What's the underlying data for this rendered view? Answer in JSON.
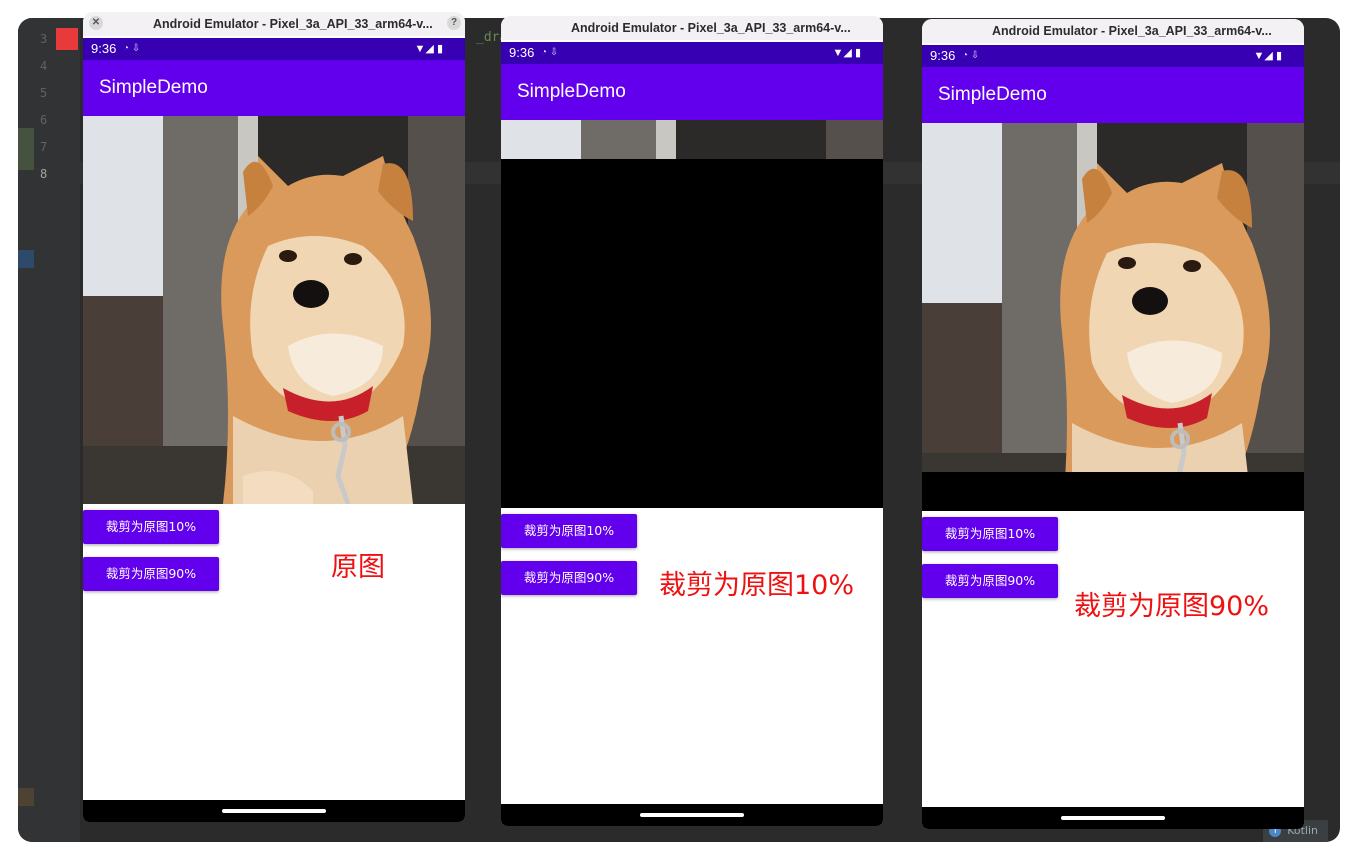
{
  "ide": {
    "line_numbers": [
      "3",
      "4",
      "5",
      "6",
      "7",
      "8"
    ],
    "code_fragment": "_dra",
    "status_language": "Kotlin"
  },
  "emulators": [
    {
      "window_title": "Android Emulator - Pixel_3a_API_33_arm64-v...",
      "time": "9:36",
      "app_title": "SimpleDemo",
      "button_crop_10": "裁剪为原图10%",
      "button_crop_90": "裁剪为原图90%",
      "annotation": "原图",
      "crop_shown_fraction": 1.0
    },
    {
      "window_title": "Android Emulator - Pixel_3a_API_33_arm64-v...",
      "time": "9:36",
      "app_title": "SimpleDemo",
      "button_crop_10": "裁剪为原图10%",
      "button_crop_90": "裁剪为原图90%",
      "annotation": "裁剪为原图10%",
      "crop_shown_fraction": 0.1
    },
    {
      "window_title": "Android Emulator - Pixel_3a_API_33_arm64-v...",
      "time": "9:36",
      "app_title": "SimpleDemo",
      "button_crop_10": "裁剪为原图10%",
      "button_crop_90": "裁剪为原图90%",
      "annotation": "裁剪为原图90%",
      "crop_shown_fraction": 0.9
    }
  ],
  "colors": {
    "app_bar": "#6200ee",
    "status_bar": "#3700b3",
    "annotation_text": "#ee1111"
  },
  "icons": {
    "status_left": [
      "wifi-icon",
      "download-icon"
    ],
    "status_right": [
      "wifi-signal-icon",
      "cell-signal-icon",
      "battery-icon"
    ]
  }
}
